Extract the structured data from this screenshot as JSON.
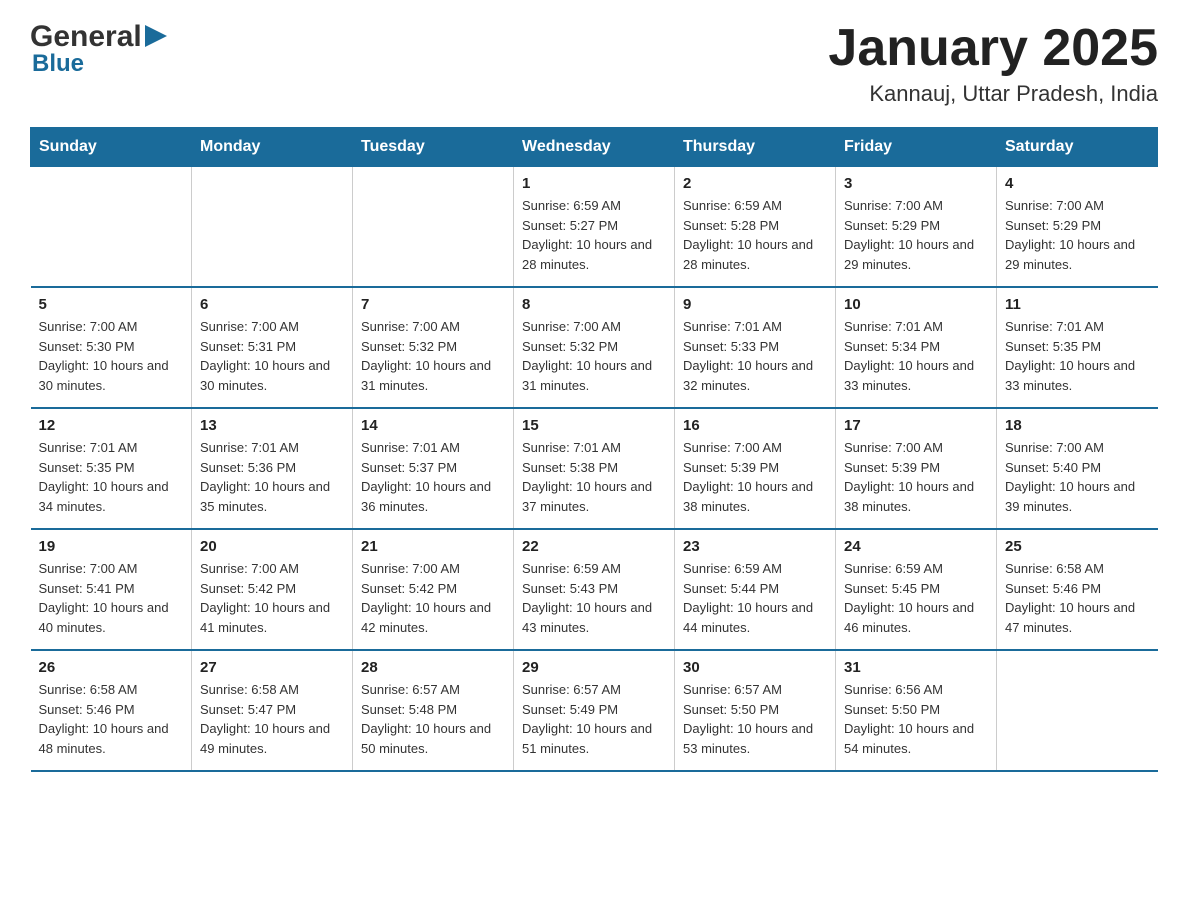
{
  "header": {
    "logo_general": "General",
    "logo_blue": "Blue",
    "title": "January 2025",
    "subtitle": "Kannauj, Uttar Pradesh, India"
  },
  "days_of_week": [
    "Sunday",
    "Monday",
    "Tuesday",
    "Wednesday",
    "Thursday",
    "Friday",
    "Saturday"
  ],
  "weeks": [
    {
      "days": [
        {
          "number": "",
          "info": ""
        },
        {
          "number": "",
          "info": ""
        },
        {
          "number": "",
          "info": ""
        },
        {
          "number": "1",
          "info": "Sunrise: 6:59 AM\nSunset: 5:27 PM\nDaylight: 10 hours and 28 minutes."
        },
        {
          "number": "2",
          "info": "Sunrise: 6:59 AM\nSunset: 5:28 PM\nDaylight: 10 hours and 28 minutes."
        },
        {
          "number": "3",
          "info": "Sunrise: 7:00 AM\nSunset: 5:29 PM\nDaylight: 10 hours and 29 minutes."
        },
        {
          "number": "4",
          "info": "Sunrise: 7:00 AM\nSunset: 5:29 PM\nDaylight: 10 hours and 29 minutes."
        }
      ]
    },
    {
      "days": [
        {
          "number": "5",
          "info": "Sunrise: 7:00 AM\nSunset: 5:30 PM\nDaylight: 10 hours and 30 minutes."
        },
        {
          "number": "6",
          "info": "Sunrise: 7:00 AM\nSunset: 5:31 PM\nDaylight: 10 hours and 30 minutes."
        },
        {
          "number": "7",
          "info": "Sunrise: 7:00 AM\nSunset: 5:32 PM\nDaylight: 10 hours and 31 minutes."
        },
        {
          "number": "8",
          "info": "Sunrise: 7:00 AM\nSunset: 5:32 PM\nDaylight: 10 hours and 31 minutes."
        },
        {
          "number": "9",
          "info": "Sunrise: 7:01 AM\nSunset: 5:33 PM\nDaylight: 10 hours and 32 minutes."
        },
        {
          "number": "10",
          "info": "Sunrise: 7:01 AM\nSunset: 5:34 PM\nDaylight: 10 hours and 33 minutes."
        },
        {
          "number": "11",
          "info": "Sunrise: 7:01 AM\nSunset: 5:35 PM\nDaylight: 10 hours and 33 minutes."
        }
      ]
    },
    {
      "days": [
        {
          "number": "12",
          "info": "Sunrise: 7:01 AM\nSunset: 5:35 PM\nDaylight: 10 hours and 34 minutes."
        },
        {
          "number": "13",
          "info": "Sunrise: 7:01 AM\nSunset: 5:36 PM\nDaylight: 10 hours and 35 minutes."
        },
        {
          "number": "14",
          "info": "Sunrise: 7:01 AM\nSunset: 5:37 PM\nDaylight: 10 hours and 36 minutes."
        },
        {
          "number": "15",
          "info": "Sunrise: 7:01 AM\nSunset: 5:38 PM\nDaylight: 10 hours and 37 minutes."
        },
        {
          "number": "16",
          "info": "Sunrise: 7:00 AM\nSunset: 5:39 PM\nDaylight: 10 hours and 38 minutes."
        },
        {
          "number": "17",
          "info": "Sunrise: 7:00 AM\nSunset: 5:39 PM\nDaylight: 10 hours and 38 minutes."
        },
        {
          "number": "18",
          "info": "Sunrise: 7:00 AM\nSunset: 5:40 PM\nDaylight: 10 hours and 39 minutes."
        }
      ]
    },
    {
      "days": [
        {
          "number": "19",
          "info": "Sunrise: 7:00 AM\nSunset: 5:41 PM\nDaylight: 10 hours and 40 minutes."
        },
        {
          "number": "20",
          "info": "Sunrise: 7:00 AM\nSunset: 5:42 PM\nDaylight: 10 hours and 41 minutes."
        },
        {
          "number": "21",
          "info": "Sunrise: 7:00 AM\nSunset: 5:42 PM\nDaylight: 10 hours and 42 minutes."
        },
        {
          "number": "22",
          "info": "Sunrise: 6:59 AM\nSunset: 5:43 PM\nDaylight: 10 hours and 43 minutes."
        },
        {
          "number": "23",
          "info": "Sunrise: 6:59 AM\nSunset: 5:44 PM\nDaylight: 10 hours and 44 minutes."
        },
        {
          "number": "24",
          "info": "Sunrise: 6:59 AM\nSunset: 5:45 PM\nDaylight: 10 hours and 46 minutes."
        },
        {
          "number": "25",
          "info": "Sunrise: 6:58 AM\nSunset: 5:46 PM\nDaylight: 10 hours and 47 minutes."
        }
      ]
    },
    {
      "days": [
        {
          "number": "26",
          "info": "Sunrise: 6:58 AM\nSunset: 5:46 PM\nDaylight: 10 hours and 48 minutes."
        },
        {
          "number": "27",
          "info": "Sunrise: 6:58 AM\nSunset: 5:47 PM\nDaylight: 10 hours and 49 minutes."
        },
        {
          "number": "28",
          "info": "Sunrise: 6:57 AM\nSunset: 5:48 PM\nDaylight: 10 hours and 50 minutes."
        },
        {
          "number": "29",
          "info": "Sunrise: 6:57 AM\nSunset: 5:49 PM\nDaylight: 10 hours and 51 minutes."
        },
        {
          "number": "30",
          "info": "Sunrise: 6:57 AM\nSunset: 5:50 PM\nDaylight: 10 hours and 53 minutes."
        },
        {
          "number": "31",
          "info": "Sunrise: 6:56 AM\nSunset: 5:50 PM\nDaylight: 10 hours and 54 minutes."
        },
        {
          "number": "",
          "info": ""
        }
      ]
    }
  ]
}
